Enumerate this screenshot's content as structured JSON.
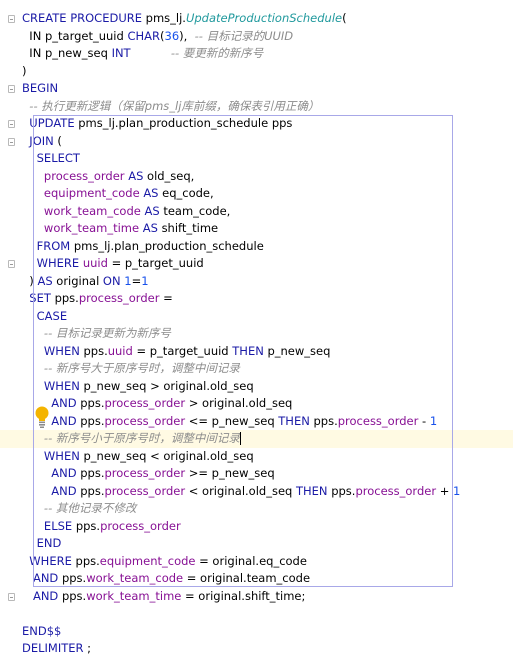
{
  "editor": {
    "lines": [
      {
        "i": 0,
        "tokens": [
          [
            "kw",
            "CREATE PROCEDURE "
          ],
          [
            "id",
            "pms_lj."
          ],
          [
            "fn",
            "UpdateProductionSchedule"
          ],
          [
            "id",
            "("
          ]
        ]
      },
      {
        "i": 1,
        "tokens": [
          [
            "id",
            "  IN p_target_uuid "
          ],
          [
            "kw",
            "CHAR"
          ],
          [
            "id",
            "("
          ],
          [
            "num",
            "36"
          ],
          [
            "id",
            "),  "
          ],
          [
            "cm",
            "-- 目标记录的UUID"
          ]
        ]
      },
      {
        "i": 2,
        "tokens": [
          [
            "id",
            "  IN p_new_seq "
          ],
          [
            "kw",
            "INT"
          ],
          [
            "id",
            "           "
          ],
          [
            "cm",
            "-- 要更新的新序号"
          ]
        ]
      },
      {
        "i": 3,
        "tokens": [
          [
            "id",
            ")"
          ]
        ]
      },
      {
        "i": 4,
        "tokens": [
          [
            "kw",
            "BEGIN"
          ]
        ]
      },
      {
        "i": 5,
        "tokens": [
          [
            "cm",
            "  -- 执行更新逻辑（保留pms_lj库前缀，确保表引用正确）"
          ]
        ]
      },
      {
        "i": 6,
        "tokens": [
          [
            "kw",
            "  UPDATE "
          ],
          [
            "id",
            "pms_lj.plan_production_schedule pps"
          ]
        ]
      },
      {
        "i": 7,
        "tokens": [
          [
            "kw",
            "  JOIN "
          ],
          [
            "id",
            "("
          ]
        ]
      },
      {
        "i": 8,
        "tokens": [
          [
            "kw",
            "    SELECT"
          ]
        ]
      },
      {
        "i": 9,
        "tokens": [
          [
            "col",
            "      process_order "
          ],
          [
            "kw",
            "AS "
          ],
          [
            "id",
            "old_seq,"
          ]
        ]
      },
      {
        "i": 10,
        "tokens": [
          [
            "col",
            "      equipment_code "
          ],
          [
            "kw",
            "AS "
          ],
          [
            "id",
            "eq_code,"
          ]
        ]
      },
      {
        "i": 11,
        "tokens": [
          [
            "col",
            "      work_team_code "
          ],
          [
            "kw",
            "AS "
          ],
          [
            "id",
            "team_code,"
          ]
        ]
      },
      {
        "i": 12,
        "tokens": [
          [
            "col",
            "      work_team_time "
          ],
          [
            "kw",
            "AS "
          ],
          [
            "id",
            "shift_time"
          ]
        ]
      },
      {
        "i": 13,
        "tokens": [
          [
            "kw",
            "    FROM "
          ],
          [
            "id",
            "pms_lj.plan_production_schedule"
          ]
        ]
      },
      {
        "i": 14,
        "tokens": [
          [
            "kw",
            "    WHERE "
          ],
          [
            "col",
            "uuid "
          ],
          [
            "id",
            "= p_target_uuid"
          ]
        ]
      },
      {
        "i": 15,
        "tokens": [
          [
            "id",
            "  ) "
          ],
          [
            "kw",
            "AS "
          ],
          [
            "id",
            "original "
          ],
          [
            "kw",
            "ON "
          ],
          [
            "num",
            "1"
          ],
          [
            "id",
            "="
          ],
          [
            "num",
            "1"
          ]
        ]
      },
      {
        "i": 16,
        "tokens": [
          [
            "kw",
            "  SET "
          ],
          [
            "id",
            "pps."
          ],
          [
            "col",
            "process_order "
          ],
          [
            "id",
            "="
          ]
        ]
      },
      {
        "i": 17,
        "tokens": [
          [
            "kw",
            "    CASE"
          ]
        ]
      },
      {
        "i": 18,
        "tokens": [
          [
            "cm",
            "      -- 目标记录更新为新序号"
          ]
        ]
      },
      {
        "i": 19,
        "tokens": [
          [
            "kw",
            "      WHEN "
          ],
          [
            "id",
            "pps."
          ],
          [
            "col",
            "uuid "
          ],
          [
            "id",
            "= p_target_uuid "
          ],
          [
            "kw",
            "THEN "
          ],
          [
            "id",
            "p_new_seq"
          ]
        ]
      },
      {
        "i": 20,
        "tokens": [
          [
            "cm",
            "      -- 新序号大于原序号时，调整中间记录"
          ]
        ]
      },
      {
        "i": 21,
        "tokens": [
          [
            "kw",
            "      WHEN "
          ],
          [
            "id",
            "p_new_seq > original.old_seq"
          ]
        ]
      },
      {
        "i": 22,
        "tokens": [
          [
            "kw",
            "        AND "
          ],
          [
            "id",
            "pps."
          ],
          [
            "col",
            "process_order "
          ],
          [
            "id",
            "> original.old_seq"
          ]
        ]
      },
      {
        "i": 23,
        "tokens": [
          [
            "kw",
            "        AND "
          ],
          [
            "id",
            "pps."
          ],
          [
            "col",
            "process_order "
          ],
          [
            "id",
            "<= p_new_seq "
          ],
          [
            "kw",
            "THEN "
          ],
          [
            "id",
            "pps."
          ],
          [
            "col",
            "process_order "
          ],
          [
            "id",
            "- "
          ],
          [
            "num",
            "1"
          ]
        ]
      },
      {
        "i": 24,
        "tokens": [
          [
            "cm",
            "      -- 新序号小于原序号时，调整中间记录"
          ]
        ]
      },
      {
        "i": 25,
        "tokens": [
          [
            "kw",
            "      WHEN "
          ],
          [
            "id",
            "p_new_seq < original.old_seq"
          ]
        ]
      },
      {
        "i": 26,
        "tokens": [
          [
            "kw",
            "        AND "
          ],
          [
            "id",
            "pps."
          ],
          [
            "col",
            "process_order "
          ],
          [
            "id",
            ">= p_new_seq"
          ]
        ]
      },
      {
        "i": 27,
        "tokens": [
          [
            "kw",
            "        AND "
          ],
          [
            "id",
            "pps."
          ],
          [
            "col",
            "process_order "
          ],
          [
            "id",
            "< original.old_seq "
          ],
          [
            "kw",
            "THEN "
          ],
          [
            "id",
            "pps."
          ],
          [
            "col",
            "process_order "
          ],
          [
            "id",
            "+ "
          ],
          [
            "num",
            "1"
          ]
        ]
      },
      {
        "i": 28,
        "tokens": [
          [
            "cm",
            "      -- 其他记录不修改"
          ]
        ]
      },
      {
        "i": 29,
        "tokens": [
          [
            "kw",
            "      ELSE "
          ],
          [
            "id",
            "pps."
          ],
          [
            "col",
            "process_order"
          ]
        ]
      },
      {
        "i": 30,
        "tokens": [
          [
            "kw",
            "    END"
          ]
        ]
      },
      {
        "i": 31,
        "tokens": [
          [
            "kw",
            "  WHERE "
          ],
          [
            "id",
            "pps."
          ],
          [
            "col",
            "equipment_code "
          ],
          [
            "id",
            "= original.eq_code"
          ]
        ]
      },
      {
        "i": 32,
        "tokens": [
          [
            "kw",
            "   AND "
          ],
          [
            "id",
            "pps."
          ],
          [
            "col",
            "work_team_code "
          ],
          [
            "id",
            "= original.team_code"
          ]
        ]
      },
      {
        "i": 33,
        "tokens": [
          [
            "kw",
            "   AND "
          ],
          [
            "id",
            "pps."
          ],
          [
            "col",
            "work_team_time "
          ],
          [
            "id",
            "= original.shift_time;"
          ]
        ]
      },
      {
        "i": 34,
        "tokens": []
      },
      {
        "i": 35,
        "tokens": [
          [
            "kw",
            "END$$"
          ]
        ]
      },
      {
        "i": 36,
        "tokens": [
          [
            "kw",
            "DELIMITER "
          ],
          [
            "id",
            ";"
          ]
        ]
      }
    ],
    "current_line": 24,
    "fold_lines": [
      0,
      4,
      6,
      7,
      14,
      33
    ],
    "intention_icon": "lightbulb-icon"
  }
}
